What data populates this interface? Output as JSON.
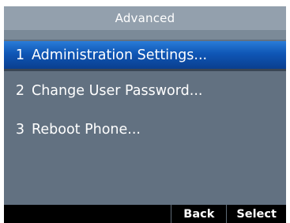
{
  "header": {
    "title": "Advanced"
  },
  "menu": {
    "items": [
      {
        "number": "1",
        "label": "Administration Settings...",
        "selected": true
      },
      {
        "number": "2",
        "label": "Change User Password...",
        "selected": false
      },
      {
        "number": "3",
        "label": "Reboot Phone...",
        "selected": false
      }
    ]
  },
  "softkeys": {
    "back_label": "Back",
    "select_label": "Select"
  },
  "colors": {
    "screen_background": "#627181",
    "title_bar": "#93a0ad",
    "selection_highlight": "#0f56b5",
    "softkey_bar": "#000000",
    "text": "#ffffff"
  }
}
